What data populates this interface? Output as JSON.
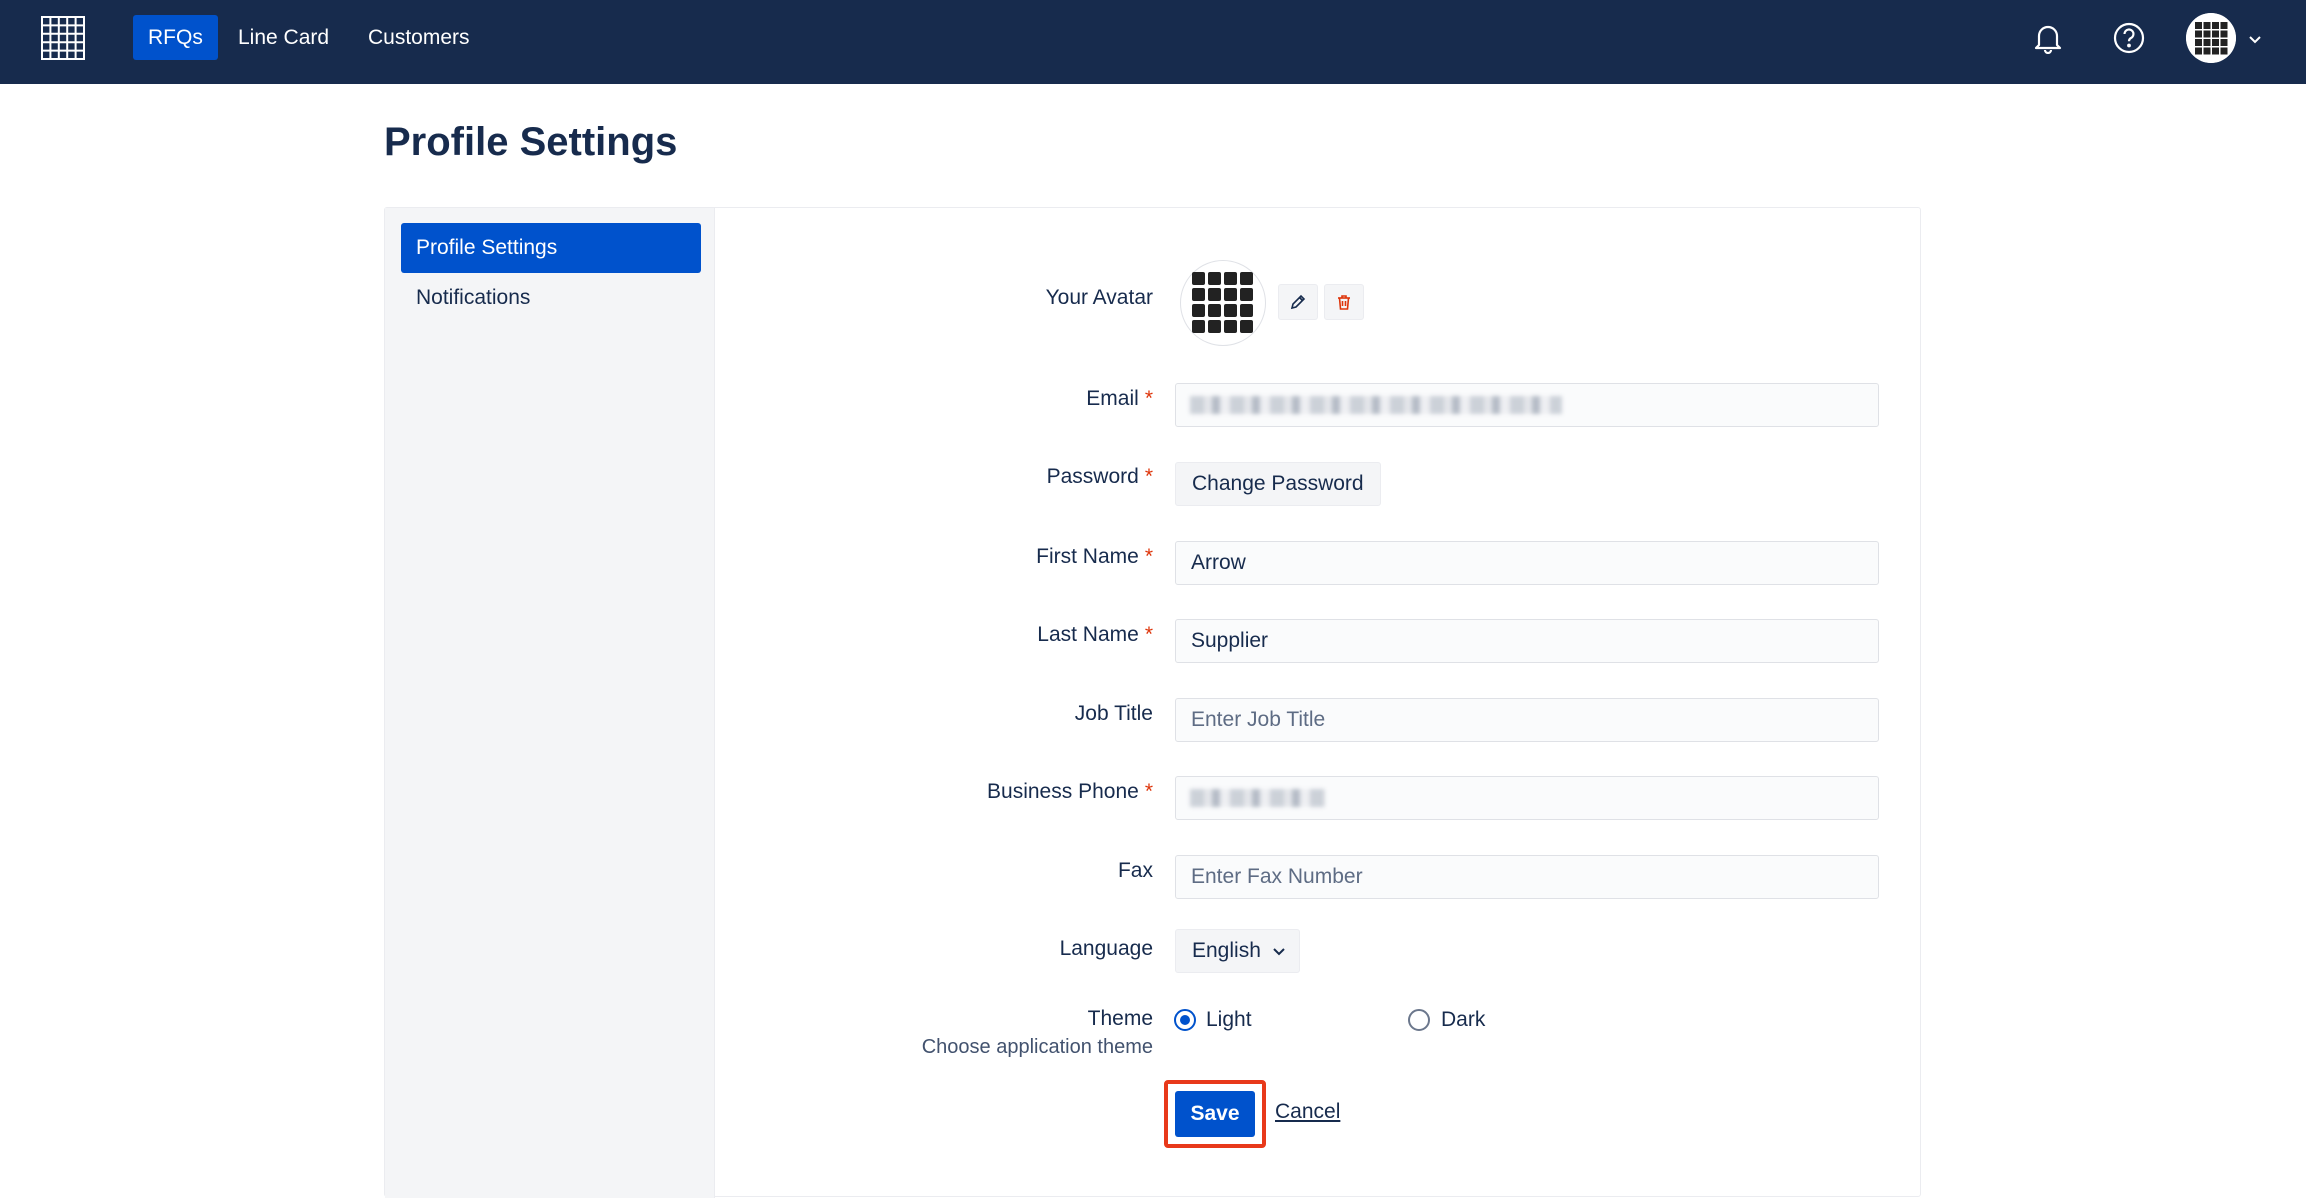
{
  "topnav": {
    "logo": "grid-logo",
    "items": [
      {
        "label": "RFQs",
        "active": true
      },
      {
        "label": "Line Card",
        "active": false
      },
      {
        "label": "Customers",
        "active": false
      }
    ],
    "icons": [
      "bell-icon",
      "help-icon",
      "user-avatar",
      "chevron-down-icon"
    ]
  },
  "page": {
    "title": "Profile Settings"
  },
  "sidebar": {
    "items": [
      {
        "label": "Profile Settings",
        "active": true
      },
      {
        "label": "Notifications",
        "active": false
      }
    ]
  },
  "form": {
    "avatar": {
      "label": "Your Avatar",
      "edit_icon": "pencil-icon",
      "delete_icon": "trash-icon"
    },
    "email": {
      "label": "Email",
      "required": true,
      "value": ""
    },
    "password": {
      "label": "Password",
      "required": true,
      "button": "Change Password"
    },
    "first_name": {
      "label": "First Name",
      "required": true,
      "value": "Arrow"
    },
    "last_name": {
      "label": "Last Name",
      "required": true,
      "value": "Supplier"
    },
    "job_title": {
      "label": "Job Title",
      "placeholder": "Enter Job Title",
      "value": ""
    },
    "business_phone": {
      "label": "Business Phone",
      "required": true,
      "value": ""
    },
    "fax": {
      "label": "Fax",
      "placeholder": "Enter Fax Number",
      "value": ""
    },
    "language": {
      "label": "Language",
      "value": "English"
    },
    "theme": {
      "label": "Theme",
      "sublabel": "Choose application theme",
      "options": [
        {
          "label": "Light",
          "checked": true
        },
        {
          "label": "Dark",
          "checked": false
        }
      ]
    },
    "save_label": "Save",
    "cancel_label": "Cancel",
    "required_marker": "*"
  },
  "colors": {
    "topbar": "#172b4d",
    "primary": "#0052cc",
    "required": "#de350b",
    "highlight": "#e8391a"
  }
}
